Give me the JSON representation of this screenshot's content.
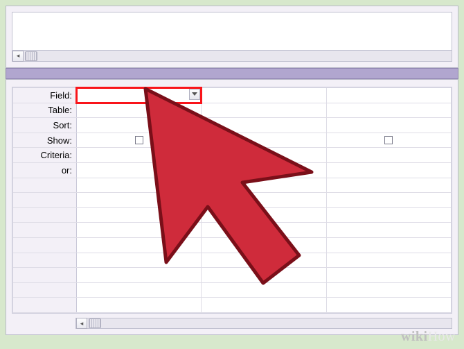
{
  "query_grid": {
    "labels": {
      "field": "Field:",
      "table": "Table:",
      "sort": "Sort:",
      "show": "Show:",
      "criteria": "Criteria:",
      "or": "or:"
    },
    "columns": [
      {
        "field": "",
        "table": "",
        "sort": "",
        "show": false,
        "criteria": "",
        "or": ""
      },
      {
        "field": "",
        "table": "",
        "sort": "",
        "show": false,
        "criteria": "",
        "or": ""
      },
      {
        "field": "",
        "table": "",
        "sort": "",
        "show": false,
        "criteria": "",
        "or": ""
      }
    ]
  },
  "scroll": {
    "left_arrow": "◂",
    "grip": ""
  },
  "dropdown": {
    "arrow": "▾"
  },
  "watermark": {
    "wiki": "wiki",
    "how": "How"
  }
}
